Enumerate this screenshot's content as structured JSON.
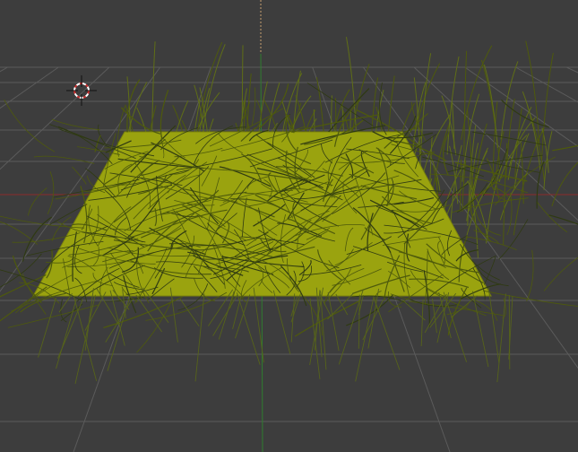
{
  "viewport": {
    "view": "3d-viewport",
    "scene": {
      "object": "plane",
      "particle_system": "hair",
      "plane_color": "#9aa30f",
      "hair_color": "#4e5a0c",
      "hair_shadow_color": "#2f3a12"
    },
    "colors": {
      "background": "#3d3d3d",
      "grid": "#5b5b5b",
      "x_axis": "#8a2b2b",
      "y_axis": "#2f7d2f",
      "z_axis_dashes": "#c8a070",
      "cursor_ring": "#cc2e2e",
      "cursor_white": "#ffffff"
    },
    "icons": {
      "cursor": "3d-cursor-icon"
    }
  }
}
